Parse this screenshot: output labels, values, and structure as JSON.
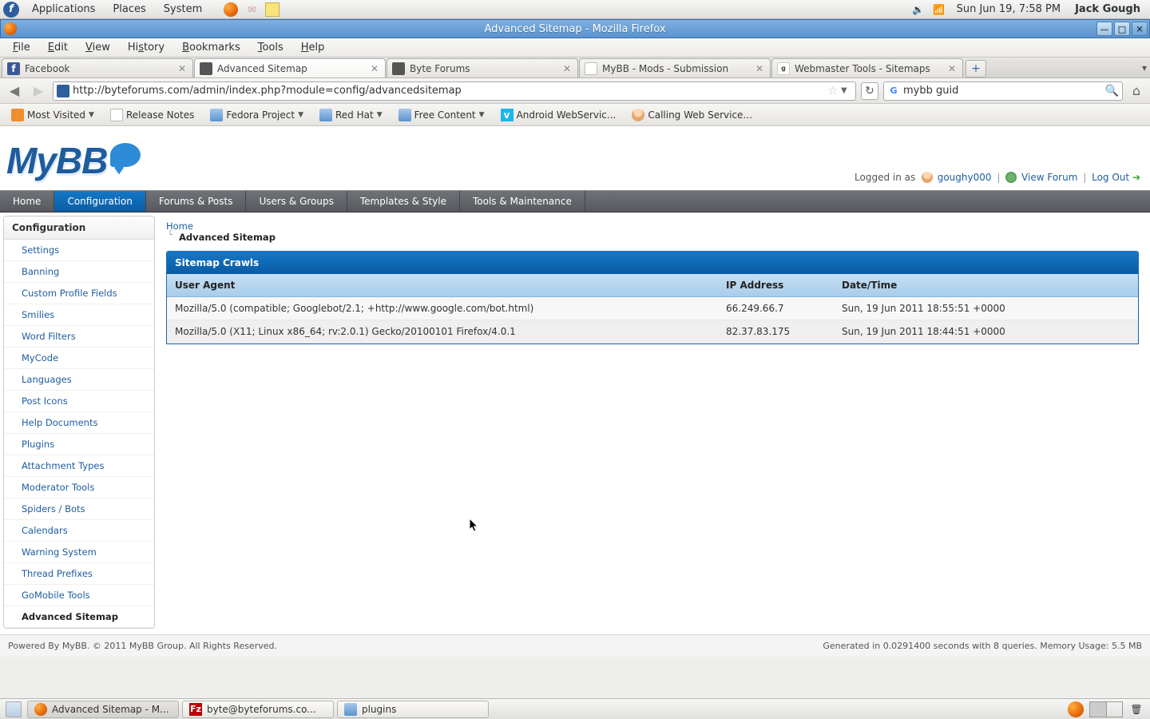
{
  "gnome": {
    "menus": [
      "Applications",
      "Places",
      "System"
    ],
    "clock": "Sun Jun 19,  7:58 PM",
    "user": "Jack Gough"
  },
  "firefox": {
    "title": "Advanced Sitemap - Mozilla Firefox",
    "menubar": [
      "File",
      "Edit",
      "View",
      "History",
      "Bookmarks",
      "Tools",
      "Help"
    ],
    "tabs": [
      {
        "label": "Facebook",
        "icon": "fb"
      },
      {
        "label": "Advanced Sitemap",
        "icon": "wrench",
        "active": true
      },
      {
        "label": "Byte Forums",
        "icon": "wrench"
      },
      {
        "label": "MyBB - Mods - Submission",
        "icon": "page"
      },
      {
        "label": "Webmaster Tools - Sitemaps",
        "icon": "goog"
      }
    ],
    "url": "http://byteforums.com/admin/index.php?module=config/advancedsitemap",
    "search_value": "mybb guid",
    "bookmarks": [
      {
        "label": "Most Visited",
        "icon": "orange",
        "dd": true
      },
      {
        "label": "Release Notes",
        "icon": "page"
      },
      {
        "label": "Fedora Project",
        "icon": "folder",
        "dd": true
      },
      {
        "label": "Red Hat",
        "icon": "folder",
        "dd": true
      },
      {
        "label": "Free Content",
        "icon": "folder",
        "dd": true
      },
      {
        "label": "Android WebServic...",
        "icon": "vimeo"
      },
      {
        "label": "Calling Web Service...",
        "icon": "user"
      }
    ]
  },
  "mybb": {
    "logged_in_as": "Logged in as",
    "username": "goughy000",
    "view_forum": "View Forum",
    "log_out": "Log Out",
    "nav": [
      "Home",
      "Configuration",
      "Forums & Posts",
      "Users & Groups",
      "Templates & Style",
      "Tools & Maintenance"
    ],
    "nav_active": 1,
    "sidebar_title": "Configuration",
    "sidebar": [
      "Settings",
      "Banning",
      "Custom Profile Fields",
      "Smilies",
      "Word Filters",
      "MyCode",
      "Languages",
      "Post Icons",
      "Help Documents",
      "Plugins",
      "Attachment Types",
      "Moderator Tools",
      "Spiders / Bots",
      "Calendars",
      "Warning System",
      "Thread Prefixes",
      "GoMobile Tools",
      "Advanced Sitemap"
    ],
    "sidebar_active": 17,
    "breadcrumb": {
      "root": "Home",
      "current": "Advanced Sitemap"
    },
    "table": {
      "title": "Sitemap Crawls",
      "headers": {
        "ua": "User Agent",
        "ip": "IP Address",
        "dt": "Date/Time"
      },
      "rows": [
        {
          "ua": "Mozilla/5.0 (compatible; Googlebot/2.1; +http://www.google.com/bot.html)",
          "ip": "66.249.66.7",
          "dt": "Sun, 19 Jun 2011 18:55:51 +0000"
        },
        {
          "ua": "Mozilla/5.0 (X11; Linux x86_64; rv:2.0.1) Gecko/20100101 Firefox/4.0.1",
          "ip": "82.37.83.175",
          "dt": "Sun, 19 Jun 2011 18:44:51 +0000"
        }
      ]
    },
    "footer_left": "Powered By MyBB. © 2011 MyBB Group. All Rights Reserved.",
    "footer_right": "Generated in 0.0291400 seconds with 8 queries. Memory Usage: 5.5 MB"
  },
  "taskbar": {
    "items": [
      {
        "label": "Advanced Sitemap - M...",
        "icon": "ff",
        "active": true
      },
      {
        "label": "byte@byteforums.co...",
        "icon": "fz"
      },
      {
        "label": "plugins",
        "icon": "folder"
      }
    ]
  }
}
